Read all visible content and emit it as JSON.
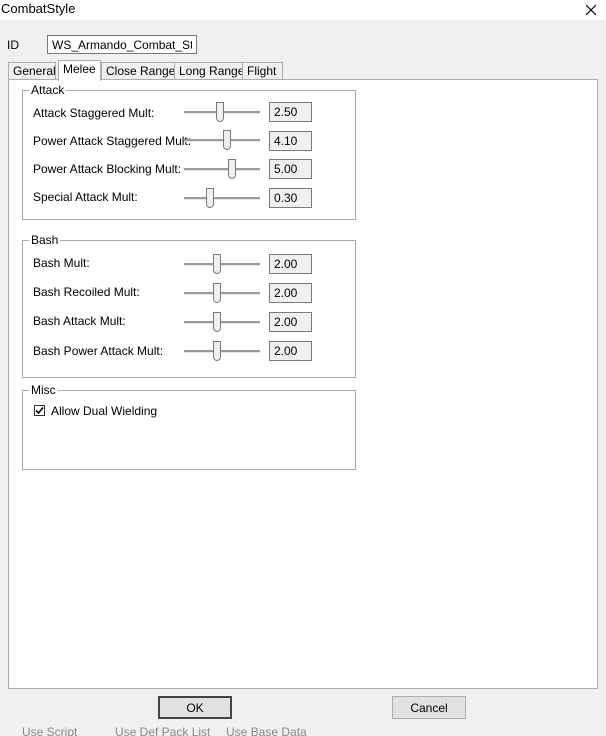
{
  "window": {
    "title": "CombatStyle"
  },
  "id_field": {
    "label": "ID",
    "value": "WS_Armando_Combat_Style"
  },
  "tabs": [
    {
      "label": "General",
      "active": false
    },
    {
      "label": "Melee",
      "active": true
    },
    {
      "label": "Close Range",
      "active": false
    },
    {
      "label": "Long Range",
      "active": false
    },
    {
      "label": "Flight",
      "active": false
    }
  ],
  "attack": {
    "title": "Attack",
    "rows": [
      {
        "label": "Attack Staggered Mult:",
        "value": "2.50",
        "slider_level": 0.47
      },
      {
        "label": "Power Attack Staggered Mult:",
        "value": "4.10",
        "slider_level": 0.57
      },
      {
        "label": "Power Attack Blocking Mult:",
        "value": "5.00",
        "slider_level": 0.63
      },
      {
        "label": "Special Attack Mult:",
        "value": "0.30",
        "slider_level": 0.34
      }
    ]
  },
  "bash": {
    "title": "Bash",
    "rows": [
      {
        "label": "Bash Mult:",
        "value": "2.00",
        "slider_level": 0.44
      },
      {
        "label": "Bash Recoiled Mult:",
        "value": "2.00",
        "slider_level": 0.44
      },
      {
        "label": "Bash Attack Mult:",
        "value": "2.00",
        "slider_level": 0.44
      },
      {
        "label": "Bash Power Attack Mult:",
        "value": "2.00",
        "slider_level": 0.44
      }
    ]
  },
  "misc": {
    "title": "Misc",
    "allow_dual_wielding": {
      "label": "Allow Dual Wielding",
      "checked": true
    }
  },
  "buttons": {
    "ok": "OK",
    "cancel": "Cancel"
  },
  "background_window": {
    "items": [
      "Use Script",
      "Use Def Pack List",
      "Use Base Data"
    ]
  },
  "colors": {
    "panel": "#ffffff",
    "dialog": "#f0f0f0",
    "border": "#adadad"
  }
}
